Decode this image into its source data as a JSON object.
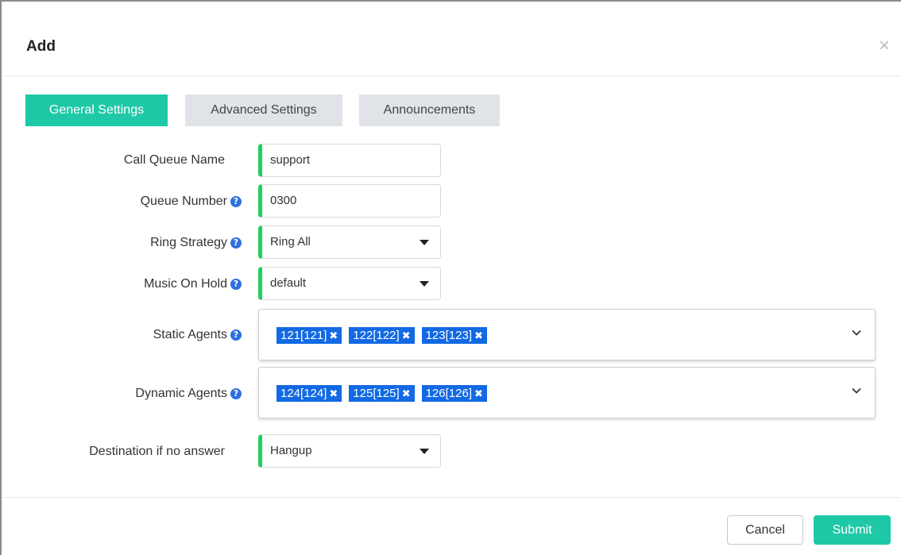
{
  "modal": {
    "title": "Add",
    "close_symbol": "×"
  },
  "tabs": [
    {
      "label": "General Settings",
      "active": true
    },
    {
      "label": "Advanced Settings",
      "active": false
    },
    {
      "label": "Announcements",
      "active": false
    }
  ],
  "form": {
    "call_queue_name": {
      "label": "Call Queue Name",
      "value": "support"
    },
    "queue_number": {
      "label": "Queue Number",
      "value": "0300"
    },
    "ring_strategy": {
      "label": "Ring Strategy",
      "value": "Ring All"
    },
    "music_on_hold": {
      "label": "Music On Hold",
      "value": "default"
    },
    "static_agents": {
      "label": "Static Agents",
      "chips": [
        "121[121]",
        "122[122]",
        "123[123]"
      ]
    },
    "dynamic_agents": {
      "label": "Dynamic Agents",
      "chips": [
        "124[124]",
        "125[125]",
        "126[126]"
      ]
    },
    "destination": {
      "label": "Destination if no answer",
      "value": "Hangup"
    }
  },
  "icons": {
    "help": "question-circle-icon",
    "help_glyph": "?",
    "chip_remove_glyph": "✖"
  },
  "buttons": {
    "cancel": "Cancel",
    "submit": "Submit"
  },
  "colors": {
    "accent": "#1fc8a7",
    "required_bar": "#1ed05c",
    "chip": "#1269e3",
    "help": "#2f6fe0"
  }
}
